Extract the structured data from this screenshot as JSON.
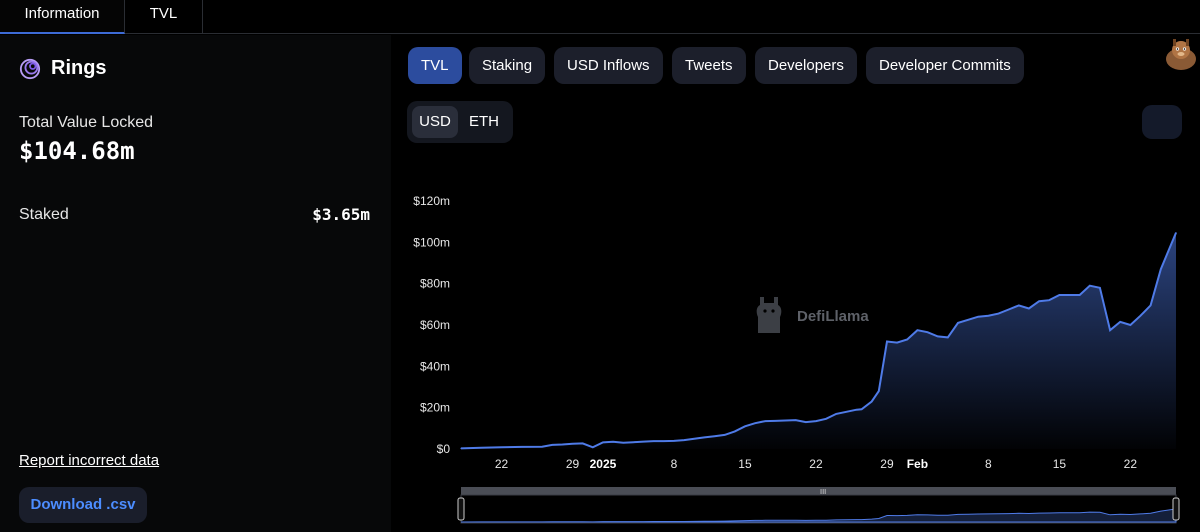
{
  "tabs": [
    {
      "label": "Information"
    },
    {
      "label": "TVL"
    }
  ],
  "protocol": {
    "name": "Rings",
    "tvl_label": "Total Value Locked",
    "tvl_value": "$104.68m",
    "staked_label": "Staked",
    "staked_value": "$3.65m"
  },
  "links": {
    "report": "Report incorrect data",
    "download": "Download .csv"
  },
  "metrics": [
    {
      "label": "TVL",
      "active": true
    },
    {
      "label": "Staking",
      "active": false
    },
    {
      "label": "USD Inflows",
      "active": false
    },
    {
      "label": "Tweets",
      "active": false
    },
    {
      "label": "Developers",
      "active": false
    },
    {
      "label": "Developer Commits",
      "active": false
    }
  ],
  "currency": {
    "options": [
      "USD",
      "ETH"
    ],
    "selected": "USD"
  },
  "watermark": "DefiLlama",
  "colors": {
    "accent": "#4f7be8",
    "active_tab": "#2c4c9e",
    "button_bg": "#1c1f2b",
    "link_blue": "#4c8dff"
  },
  "chart_data": {
    "type": "area",
    "title": "",
    "xlabel": "",
    "ylabel": "",
    "ylim": [
      0,
      120
    ],
    "y_ticks": [
      "$0",
      "$20m",
      "$40m",
      "$60m",
      "$80m",
      "$100m",
      "$120m"
    ],
    "y_tick_values": [
      0,
      20,
      40,
      60,
      80,
      100,
      120
    ],
    "x_ticks": [
      {
        "label": "22",
        "day": 4,
        "bold": false
      },
      {
        "label": "29",
        "day": 11,
        "bold": false
      },
      {
        "label": "2025",
        "day": 14,
        "bold": true
      },
      {
        "label": "8",
        "day": 21,
        "bold": false
      },
      {
        "label": "15",
        "day": 28,
        "bold": false
      },
      {
        "label": "22",
        "day": 35,
        "bold": false
      },
      {
        "label": "29",
        "day": 42,
        "bold": false
      },
      {
        "label": "Feb",
        "day": 45,
        "bold": true
      },
      {
        "label": "8",
        "day": 52,
        "bold": false
      },
      {
        "label": "15",
        "day": 59,
        "bold": false
      },
      {
        "label": "22",
        "day": 66,
        "bold": false
      }
    ],
    "x_range": [
      0,
      70.5
    ],
    "series": [
      {
        "values_musd": [
          [
            0,
            0.3
          ],
          [
            2,
            0.6
          ],
          [
            4,
            0.8
          ],
          [
            6,
            1.0
          ],
          [
            8,
            1.1
          ],
          [
            9,
            2.0
          ],
          [
            10,
            2.2
          ],
          [
            11,
            2.5
          ],
          [
            12,
            2.7
          ],
          [
            13,
            0.8
          ],
          [
            14,
            3.2
          ],
          [
            15,
            3.5
          ],
          [
            16,
            3.0
          ],
          [
            17,
            3.3
          ],
          [
            18,
            3.6
          ],
          [
            19,
            3.8
          ],
          [
            20,
            3.8
          ],
          [
            21,
            3.9
          ],
          [
            22,
            4.3
          ],
          [
            23,
            5.0
          ],
          [
            24,
            5.6
          ],
          [
            25,
            6.2
          ],
          [
            26,
            6.8
          ],
          [
            27,
            8.5
          ],
          [
            28,
            11.0
          ],
          [
            29,
            12.5
          ],
          [
            30,
            13.5
          ],
          [
            31,
            13.6
          ],
          [
            32,
            13.8
          ],
          [
            33,
            14.0
          ],
          [
            34,
            13.0
          ],
          [
            35,
            13.5
          ],
          [
            36,
            14.6
          ],
          [
            37,
            17.0
          ],
          [
            38,
            18.0
          ],
          [
            39,
            19.0
          ],
          [
            39.5,
            19.2
          ],
          [
            40.5,
            23.0
          ],
          [
            41.2,
            28.0
          ],
          [
            42,
            52.0
          ],
          [
            43,
            51.5
          ],
          [
            44,
            53.0
          ],
          [
            45,
            57.5
          ],
          [
            46,
            56.5
          ],
          [
            47,
            54.5
          ],
          [
            48,
            54.0
          ],
          [
            49,
            61.0
          ],
          [
            50,
            62.5
          ],
          [
            51,
            64.0
          ],
          [
            52,
            64.5
          ],
          [
            53,
            65.5
          ],
          [
            54,
            67.5
          ],
          [
            55,
            69.5
          ],
          [
            56,
            68.0
          ],
          [
            57,
            71.5
          ],
          [
            58,
            72.0
          ],
          [
            59,
            74.5
          ],
          [
            60,
            74.5
          ],
          [
            61,
            74.5
          ],
          [
            62,
            79.0
          ],
          [
            63,
            78.0
          ],
          [
            64,
            57.5
          ],
          [
            65,
            61.5
          ],
          [
            66,
            60.0
          ],
          [
            67,
            64.5
          ],
          [
            68,
            69.5
          ],
          [
            69,
            87.0
          ],
          [
            70.5,
            104.68
          ]
        ]
      }
    ],
    "grid": false,
    "legend": "none"
  }
}
